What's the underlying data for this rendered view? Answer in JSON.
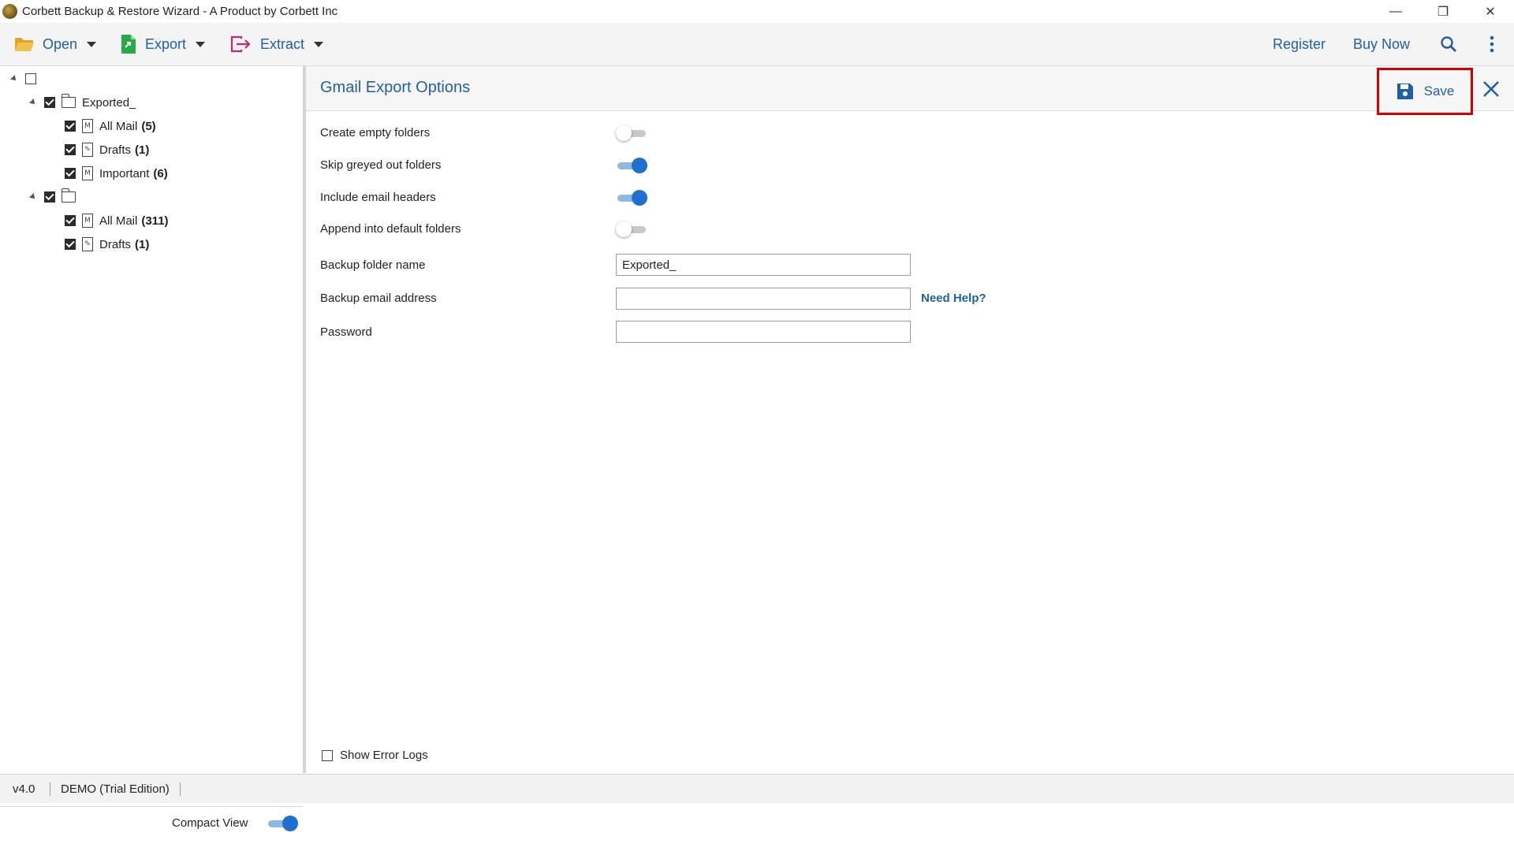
{
  "window": {
    "title": "Corbett Backup & Restore Wizard - A Product by Corbett Inc",
    "minimize": "—",
    "restore": "❐",
    "close": "✕"
  },
  "toolbar": {
    "open_label": "Open",
    "export_label": "Export",
    "extract_label": "Extract",
    "register_label": "Register",
    "buy_now_label": "Buy Now"
  },
  "tree": {
    "root": {
      "checked": false
    },
    "accounts": [
      {
        "label": "Exported_",
        "checked": true,
        "folders": [
          {
            "label": "All Mail",
            "count": "(5)",
            "icon": "mail-file-icon"
          },
          {
            "label": "Drafts",
            "count": "(1)",
            "icon": "draft-file-icon"
          },
          {
            "label": "Important",
            "count": "(6)",
            "icon": "mail-file-icon"
          }
        ]
      },
      {
        "label": "",
        "checked": true,
        "folders": [
          {
            "label": "All Mail",
            "count": "(311)",
            "icon": "mail-file-icon"
          },
          {
            "label": "Drafts",
            "count": "(1)",
            "icon": "draft-file-icon"
          }
        ]
      }
    ]
  },
  "left_footer": {
    "compact_view_label": "Compact View",
    "compact_view_on": true
  },
  "panel": {
    "title": "Gmail Export Options",
    "save_label": "Save",
    "options": [
      {
        "label": "Create empty folders",
        "on": false
      },
      {
        "label": "Skip greyed out folders",
        "on": true
      },
      {
        "label": "Include email headers",
        "on": true
      },
      {
        "label": "Append into default folders",
        "on": false
      }
    ],
    "backup_folder_name_label": "Backup folder name",
    "backup_folder_name_value": "Exported_",
    "backup_email_label": "Backup email address",
    "backup_email_value": "",
    "need_help_label": "Need Help?",
    "password_label": "Password",
    "password_value": "",
    "show_error_logs_label": "Show Error Logs"
  },
  "status": {
    "version": "v4.0",
    "edition": "DEMO (Trial Edition)"
  },
  "colors": {
    "accent": "#1f5fa8",
    "toggle_on": "#1f6fd1",
    "highlight": "#d40000"
  }
}
